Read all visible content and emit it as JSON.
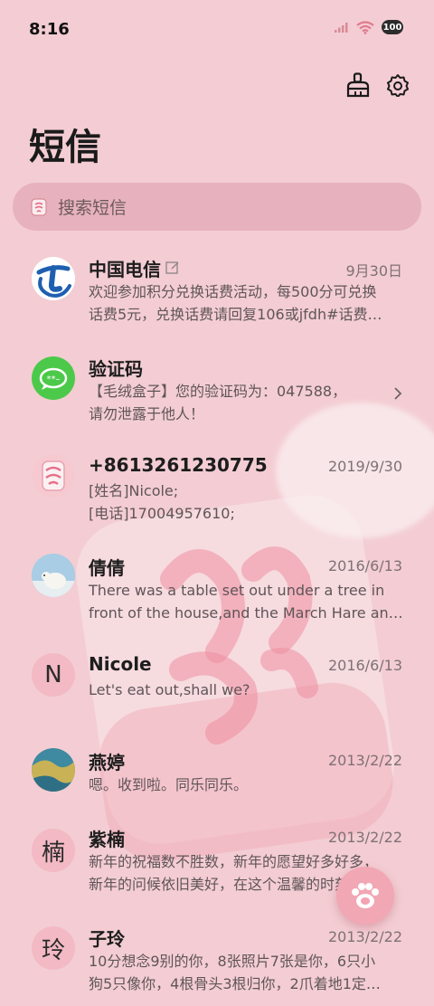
{
  "status": {
    "time": "8:16",
    "battery": "100"
  },
  "page": {
    "title": "短信"
  },
  "search": {
    "placeholder": "搜索短信"
  },
  "messages": [
    {
      "name": "中国电信",
      "date": "9月30日",
      "preview": "欢迎参加积分兑换话费活动，每500分可兑换\n话费5元，兑换话费请回复106或jfdh#话费…",
      "avatar": "telecom-logo"
    },
    {
      "name": "验证码",
      "date": "",
      "preview": "【毛绒盒子】您的验证码为：047588，\n请勿泄露于他人！",
      "avatar": "message-bubble"
    },
    {
      "name": "+8613261230775",
      "date": "2019/9/30",
      "preview": "[姓名]Nicole;\n[电话]17004957610;",
      "avatar": "mahjong-tile"
    },
    {
      "name": "倩倩",
      "date": "2016/6/13",
      "preview": "There was a table set out under a tree in\nfront of the house,and the March Hare an…",
      "avatar": "polar-bear-photo"
    },
    {
      "name": "Nicole",
      "date": "2016/6/13",
      "preview": "Let's eat out,shall we?",
      "avatar_letter": "N"
    },
    {
      "name": "燕婷",
      "date": "2013/2/22",
      "preview": "嗯。收到啦。同乐同乐。",
      "avatar": "landscape-photo"
    },
    {
      "name": "紫楠",
      "date": "2013/2/22",
      "preview": "新年的祝福数不胜数，新年的愿望好多好多，\n新年的问候依旧美好，在这个温馨的时刻…",
      "avatar_letter": "楠"
    },
    {
      "name": "子玲",
      "date": "2013/2/22",
      "preview": "10分想念9别的你，8张照片7张是你，6只小\n狗5只像你，4根骨头3根归你，2爪着地1定…",
      "avatar_letter": "玲"
    }
  ],
  "colors": {
    "background": "#f3cdd3",
    "search_bg": "#e7b2bd",
    "avatar_letter_bg": "#f3b9c4",
    "fab": "#f1a7b4"
  }
}
